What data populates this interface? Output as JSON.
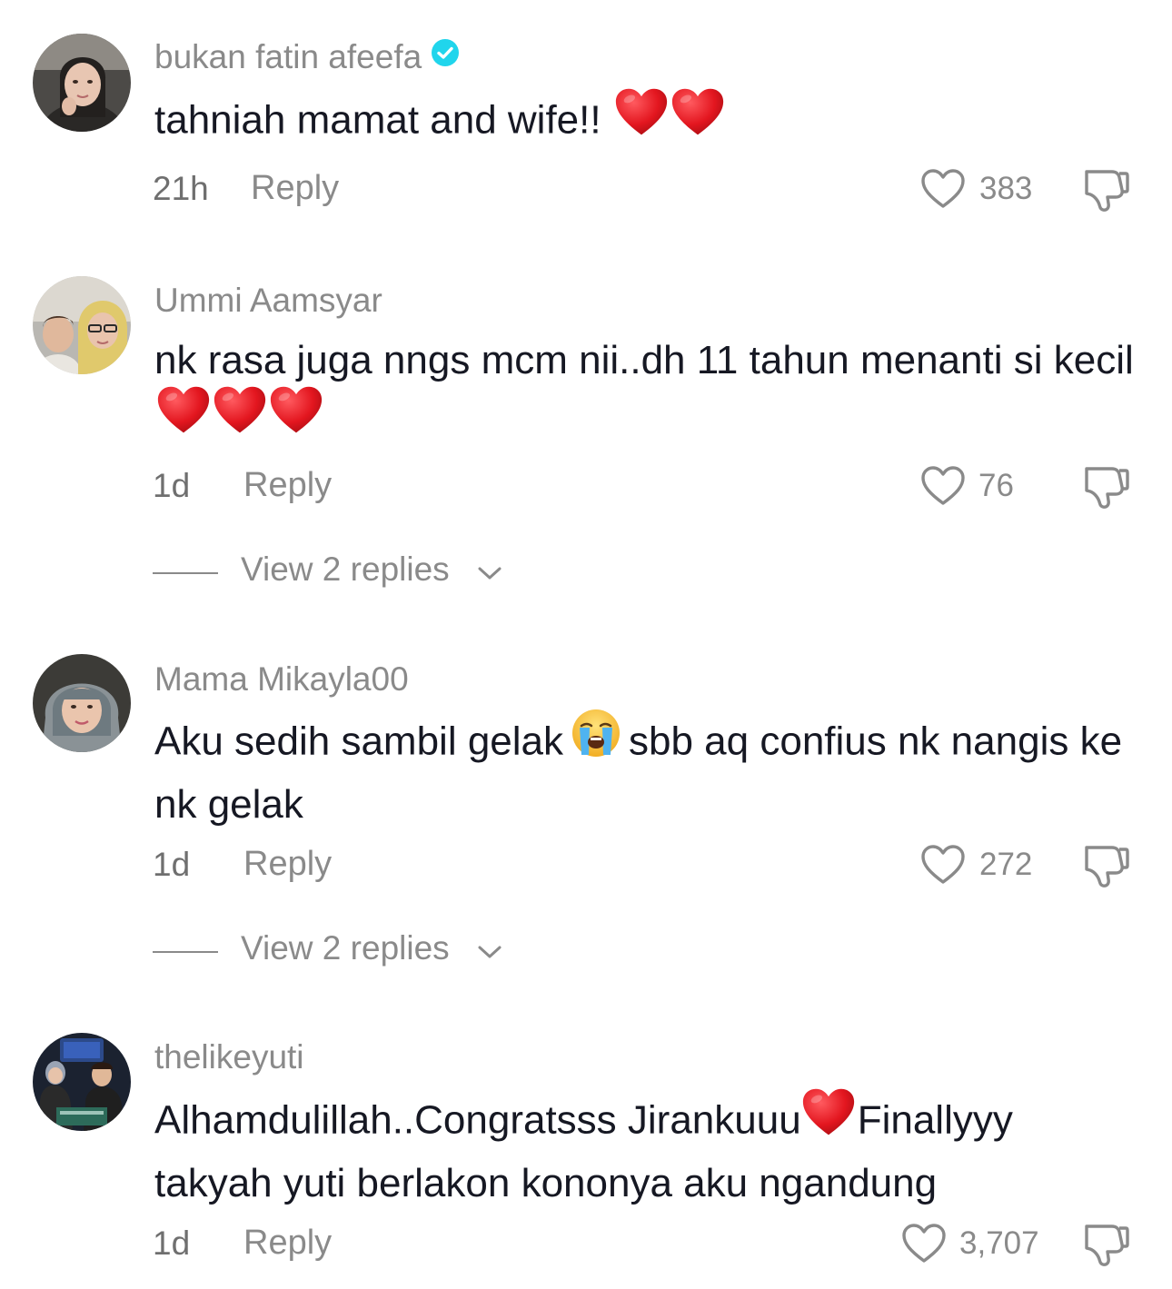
{
  "colors": {
    "text_primary": "#161823",
    "text_secondary": "#8a8a8a",
    "verified": "#20d5ec",
    "heart_emoji": "#e0141e"
  },
  "comments": [
    {
      "username": "bukan fatin afeefa",
      "verified": true,
      "text": "tahniah mamat and wife!!",
      "emoji": "❤️❤️",
      "time": "21h",
      "reply_label": "Reply",
      "likes": "383",
      "avatar_icon": "avatar-photo"
    },
    {
      "username": "Ummi Aamsyar",
      "verified": false,
      "text": "nk rasa juga nngs mcm nii..dh 11 tahun menanti si kecil",
      "emoji": "❤️❤️❤️",
      "time": "1d",
      "reply_label": "Reply",
      "likes": "76",
      "view_replies": "View 2 replies",
      "avatar_icon": "avatar-photo"
    },
    {
      "username": "Mama Mikayla00",
      "verified": false,
      "text_before": "Aku sedih sambil gelak",
      "emoji": "😭",
      "text_after": "sbb aq confius nk nangis ke nk gelak",
      "time": "1d",
      "reply_label": "Reply",
      "likes": "272",
      "view_replies": "View 2 replies",
      "avatar_icon": "avatar-photo"
    },
    {
      "username": "thelikeyuti",
      "verified": false,
      "text_before": "Alhamdulillah..Congratsss Jirankuuu",
      "emoji": "❤️",
      "text_after": "Finallyyy takyah yuti berlakon kononya aku ngandung",
      "time": "1d",
      "reply_label": "Reply",
      "likes": "3,707",
      "avatar_icon": "avatar-photo"
    }
  ]
}
